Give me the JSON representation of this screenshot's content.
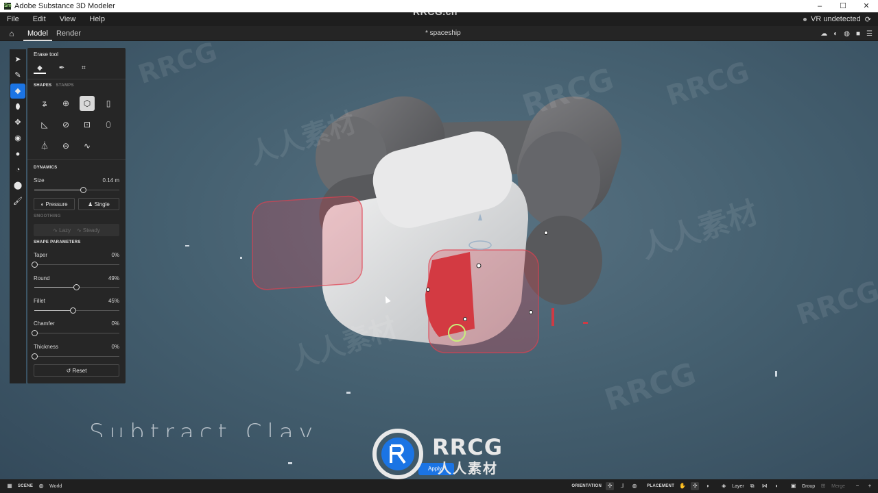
{
  "window": {
    "title": "Adobe Substance 3D Modeler",
    "app_icon": "Sm",
    "controls": [
      "–",
      "☐",
      "✕"
    ]
  },
  "menu": {
    "items": [
      "File",
      "Edit",
      "View",
      "Help"
    ],
    "vr_status": "VR undetected"
  },
  "toolbar": {
    "tabs": [
      "Model",
      "Render"
    ],
    "active_tab": "Model",
    "document": "* spaceship"
  },
  "erase_panel": {
    "title": "Erase tool",
    "shapes_tab": "SHAPES",
    "stamps_tab": "STAMPS",
    "dynamics": {
      "heading": "DYNAMICS",
      "size_label": "Size",
      "size_value": "0.14 m",
      "size_level": 0.57,
      "pressure_label": "Pressure",
      "single_label": "Single"
    },
    "smoothing": {
      "heading": "SMOOTHING",
      "lazy_label": "Lazy",
      "steady_label": "Steady"
    },
    "shape_parameters": {
      "heading": "SHAPE PARAMETERS",
      "params": [
        {
          "label": "Taper",
          "value": "0%",
          "level": 0.0
        },
        {
          "label": "Round",
          "value": "49%",
          "level": 0.49
        },
        {
          "label": "Fillet",
          "value": "45%",
          "level": 0.45
        },
        {
          "label": "Chamfer",
          "value": "0%",
          "level": 0.0
        },
        {
          "label": "Thickness",
          "value": "0%",
          "level": 0.0
        }
      ],
      "reset_label": "Reset"
    }
  },
  "viewport": {
    "caption": "Subtract Clay",
    "apply_label": "Apply"
  },
  "watermark": {
    "top": "RRCG.cn",
    "logo_en": "RRCG",
    "logo_cn": "人人素材",
    "tiles_en": "RRCG",
    "tiles_cn": "人人素材"
  },
  "statusbar": {
    "scene_label": "SCENE",
    "world_label": "World",
    "orientation_label": "ORIENTATION",
    "placement_label": "PLACEMENT",
    "layer_label": "Layer",
    "group_label": "Group",
    "merge_label": "Merge"
  },
  "colors": {
    "accent": "#1b74e4",
    "panel": "#262626",
    "viewport": "#4a6474",
    "erase_volume": "#e04050"
  }
}
